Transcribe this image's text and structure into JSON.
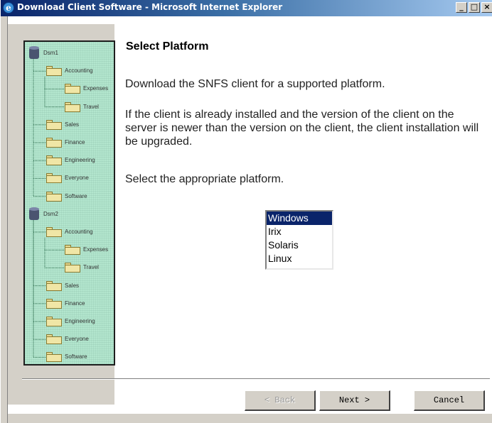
{
  "window": {
    "title": "Download Client Software - Microsoft Internet Explorer",
    "controls": {
      "minimize": "_",
      "maximize": "□",
      "close": "×"
    }
  },
  "tree": {
    "nodes": [
      {
        "label": "Dsm1",
        "type": "drive",
        "level": 0
      },
      {
        "label": "Accounting",
        "type": "folder",
        "level": 1
      },
      {
        "label": "Expenses",
        "type": "folder",
        "level": 2
      },
      {
        "label": "Travel",
        "type": "folder",
        "level": 2
      },
      {
        "label": "Sales",
        "type": "folder",
        "level": 1
      },
      {
        "label": "Finance",
        "type": "folder",
        "level": 1
      },
      {
        "label": "Engineering",
        "type": "folder",
        "level": 1
      },
      {
        "label": "Everyone",
        "type": "folder",
        "level": 1
      },
      {
        "label": "Software",
        "type": "folder",
        "level": 1
      },
      {
        "label": "Dsm2",
        "type": "drive",
        "level": 0
      },
      {
        "label": "Accounting",
        "type": "folder",
        "level": 1
      },
      {
        "label": "Expenses",
        "type": "folder",
        "level": 2
      },
      {
        "label": "Travel",
        "type": "folder",
        "level": 2
      },
      {
        "label": "Sales",
        "type": "folder",
        "level": 1
      },
      {
        "label": "Finance",
        "type": "folder",
        "level": 1
      },
      {
        "label": "Engineering",
        "type": "folder",
        "level": 1
      },
      {
        "label": "Everyone",
        "type": "folder",
        "level": 1
      },
      {
        "label": "Software",
        "type": "folder",
        "level": 1
      }
    ]
  },
  "main": {
    "heading": "Select Platform",
    "intro": "Download the SNFS client for a supported platform.",
    "upgrade_note": "If the client is already installed and the version of the client on the server is newer than the version on the client, the client installation will be upgraded.",
    "instruction": "Select the appropriate platform.",
    "platforms": [
      "Windows",
      "Irix",
      "Solaris",
      "Linux"
    ],
    "selected_platform": "Windows"
  },
  "buttons": {
    "back": "< Back",
    "next": "Next >",
    "cancel": "Cancel"
  }
}
